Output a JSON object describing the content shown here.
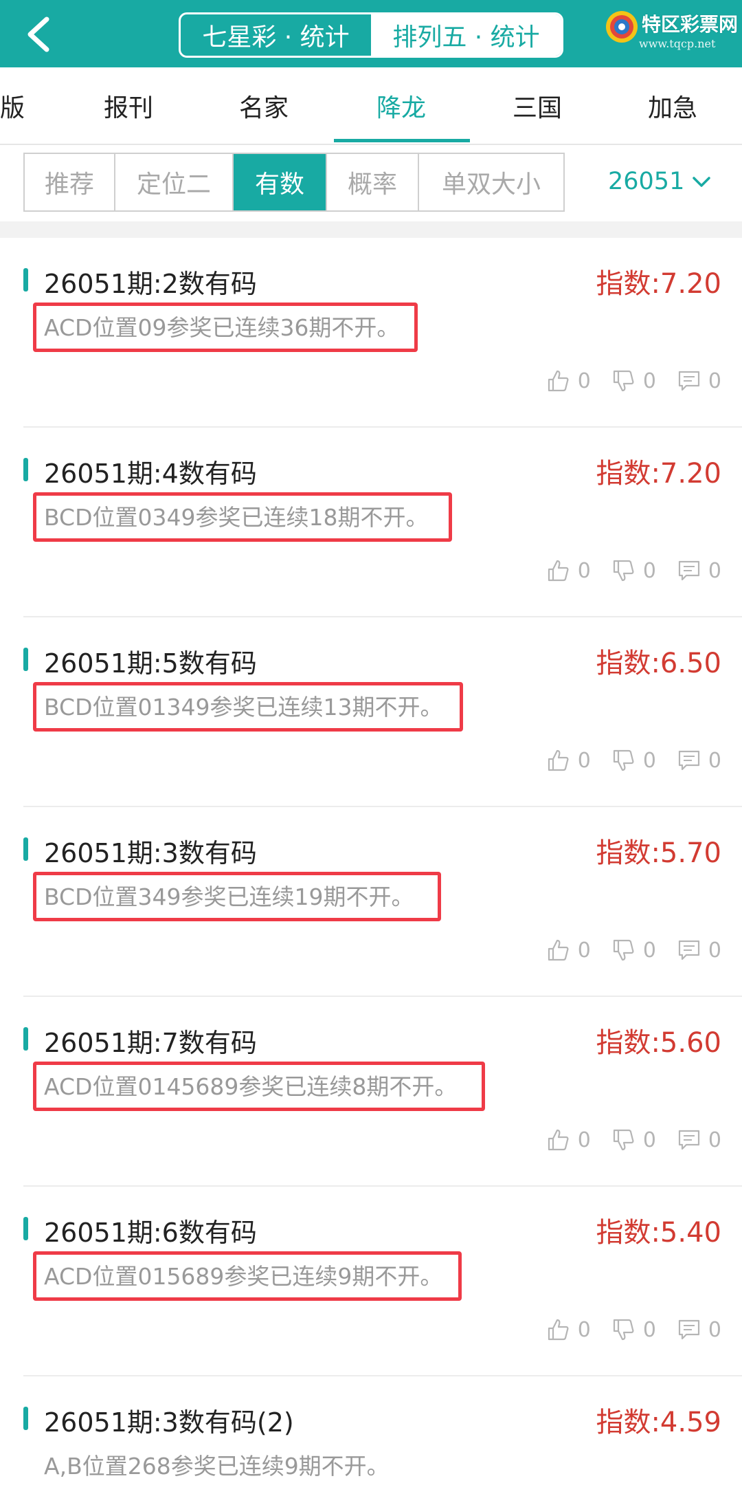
{
  "header": {
    "segments": [
      {
        "label": "七星彩 · 统计",
        "active": false
      },
      {
        "label": "排列五 · 统计",
        "active": true
      }
    ],
    "logo": {
      "title": "特区彩票网",
      "url": "www.tqcp.net"
    }
  },
  "categories": [
    {
      "label": "版"
    },
    {
      "label": "报刊"
    },
    {
      "label": "名家"
    },
    {
      "label": "降龙",
      "active": true
    },
    {
      "label": "三国"
    },
    {
      "label": "加急"
    }
  ],
  "subtabs": [
    {
      "label": "推荐"
    },
    {
      "label": "定位二"
    },
    {
      "label": "有数",
      "active": true
    },
    {
      "label": "概率"
    },
    {
      "label": "单双大小"
    }
  ],
  "period": "26051",
  "items": [
    {
      "title": "26051期:2数有码",
      "index": "指数:7.20",
      "desc": "ACD位置09参奖已连续36期不开。",
      "likes": "0",
      "dislikes": "0",
      "comments": "0"
    },
    {
      "title": "26051期:4数有码",
      "index": "指数:7.20",
      "desc": "BCD位置0349参奖已连续18期不开。",
      "likes": "0",
      "dislikes": "0",
      "comments": "0"
    },
    {
      "title": "26051期:5数有码",
      "index": "指数:6.50",
      "desc": "BCD位置01349参奖已连续13期不开。",
      "likes": "0",
      "dislikes": "0",
      "comments": "0"
    },
    {
      "title": "26051期:3数有码",
      "index": "指数:5.70",
      "desc": "BCD位置349参奖已连续19期不开。",
      "likes": "0",
      "dislikes": "0",
      "comments": "0"
    },
    {
      "title": "26051期:7数有码",
      "index": "指数:5.60",
      "desc": "ACD位置0145689参奖已连续8期不开。",
      "likes": "0",
      "dislikes": "0",
      "comments": "0"
    },
    {
      "title": "26051期:6数有码",
      "index": "指数:5.40",
      "desc": "ACD位置015689参奖已连续9期不开。",
      "likes": "0",
      "dislikes": "0",
      "comments": "0"
    },
    {
      "title": "26051期:3数有码(2)",
      "index": "指数:4.59",
      "desc": "A,B位置268参奖已连续9期不开。"
    }
  ],
  "colors": {
    "accent": "#18aaa3",
    "index_red": "#d23b32",
    "highlight_box": "#ef3b47"
  }
}
